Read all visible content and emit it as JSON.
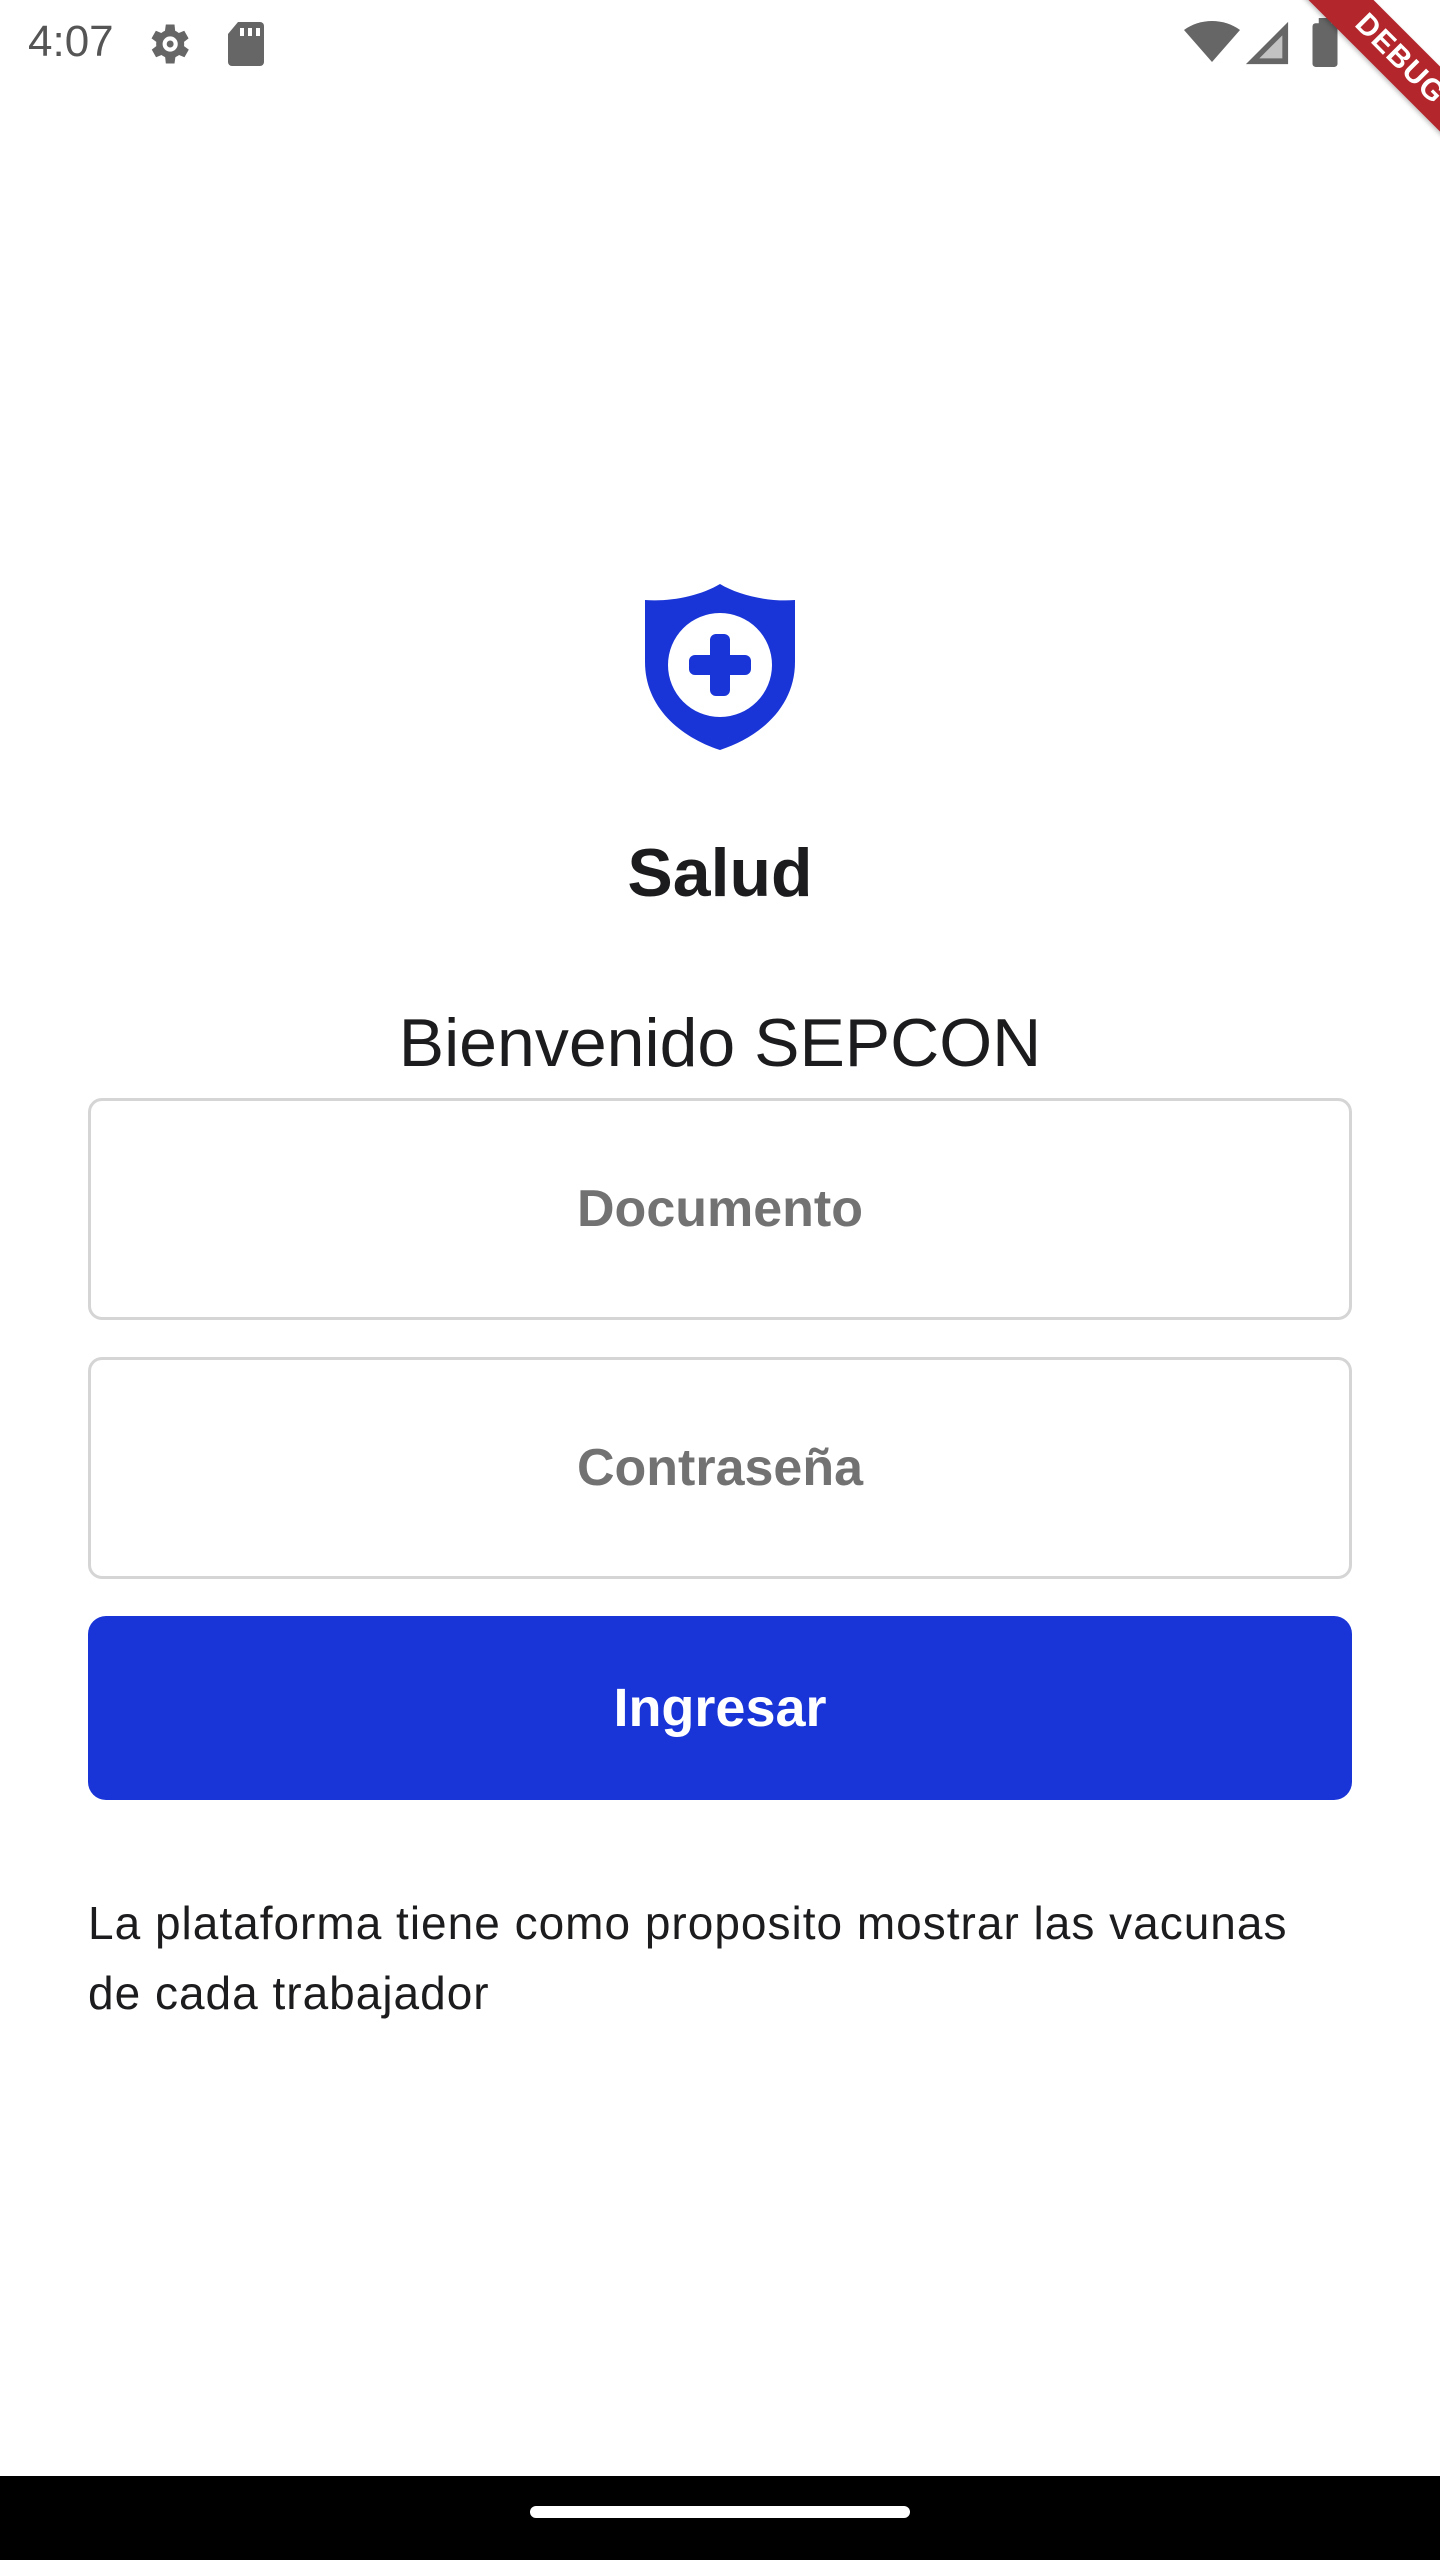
{
  "status_bar": {
    "time": "4:07",
    "icons": [
      "gear-icon",
      "sd-card-icon",
      "wifi-icon",
      "cell-signal-icon",
      "battery-icon"
    ]
  },
  "debug_banner": {
    "label": "DEBUG"
  },
  "app": {
    "logo_icon": "shield-plus-icon",
    "title": "Salud",
    "welcome": "Bienvenido SEPCON"
  },
  "form": {
    "documento_placeholder": "Documento",
    "documento_value": "",
    "password_placeholder": "Contraseña",
    "password_value": "",
    "submit_label": "Ingresar"
  },
  "description": "La plataforma tiene como proposito mostrar las vacunas de cada trabajador",
  "colors": {
    "accent": "#1935d8",
    "debug_banner": "#b3262c",
    "text": "#1c1c1e",
    "placeholder": "#727272",
    "field_border": "#d5d5d5"
  }
}
